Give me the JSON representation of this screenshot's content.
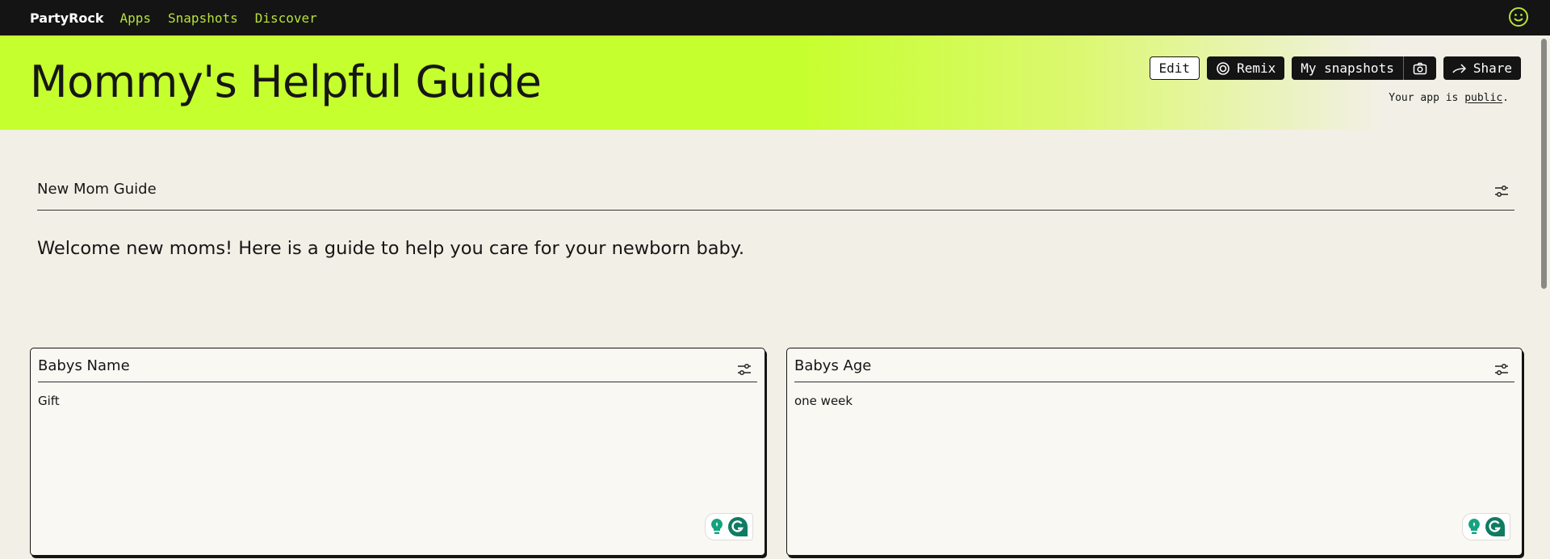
{
  "topbar": {
    "logo": "PartyRock",
    "nav": [
      "Apps",
      "Snapshots",
      "Discover"
    ],
    "profile_icon": "smiley-icon"
  },
  "header": {
    "title": "Mommy's Helpful Guide",
    "buttons": {
      "edit": "Edit",
      "remix": "Remix",
      "snapshots": "My snapshots",
      "share": "Share"
    },
    "visibility_prefix": "Your app is ",
    "visibility_link": "public",
    "visibility_suffix": "."
  },
  "section": {
    "title": "New Mom Guide",
    "text": "Welcome new moms! Here is a guide to help you care for your newborn baby."
  },
  "cards": [
    {
      "title": "Babys Name",
      "value": "Gift"
    },
    {
      "title": "Babys Age",
      "value": "one week"
    }
  ],
  "colors": {
    "accent": "#c6ff2e",
    "nav": "#b8e23a",
    "dark": "#141414",
    "grammarly": "#15a37f"
  }
}
